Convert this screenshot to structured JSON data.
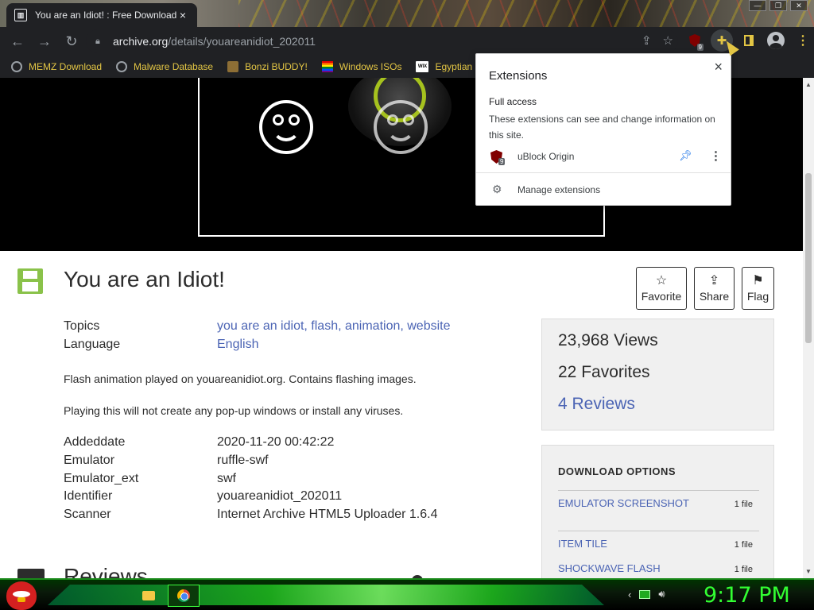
{
  "tab": {
    "title": "You are an Idiot! : Free Download",
    "favicon": "archive-org-icon",
    "close": "×"
  },
  "window_controls": {
    "minimize": "—",
    "maximize": "❐",
    "close": "✕"
  },
  "nav": {
    "back": "←",
    "forward": "→",
    "reload": "↻"
  },
  "omnibox": {
    "host": "archive.org",
    "path": "/details/youareanidiot_202011"
  },
  "extension_badge": "9",
  "bookmarks": [
    {
      "label": "MEMZ Download",
      "icon": "globe-icon"
    },
    {
      "label": "Malware Database",
      "icon": "globe-icon"
    },
    {
      "label": "Bonzi BUDDY!",
      "icon": "bonzi-icon"
    },
    {
      "label": "Windows ISOs",
      "icon": "rainbow-flag-icon"
    },
    {
      "label": "Egyptian Er",
      "icon": "wix-icon"
    }
  ],
  "wix_text": "WIX",
  "item": {
    "title": "You are an Idiot!",
    "actions": {
      "favorite": "Favorite",
      "share": "Share",
      "flag": "Flag"
    },
    "topics_label": "Topics",
    "topics_value": "you are an idiot, flash, animation, website",
    "language_label": "Language",
    "language_value": "English",
    "description_1": "Flash animation played on youareanidiot.org. Contains flashing images.",
    "description_2": "Playing this will not create any pop-up windows or install any viruses.",
    "metadata": [
      {
        "label": "Addeddate",
        "value": "2020-11-20 00:42:22"
      },
      {
        "label": "Emulator",
        "value": "ruffle-swf"
      },
      {
        "label": "Emulator_ext",
        "value": "swf"
      },
      {
        "label": "Identifier",
        "value": "youareanidiot_202011"
      },
      {
        "label": "Scanner",
        "value": "Internet Archive HTML5 Uploader 1.6.4"
      }
    ],
    "reviews_heading": "Reviews"
  },
  "stats": {
    "views": "23,968 Views",
    "favorites": "22 Favorites",
    "reviews": "4 Reviews"
  },
  "downloads": {
    "title": "DOWNLOAD OPTIONS",
    "items": [
      {
        "label": "EMULATOR SCREENSHOT",
        "count": "1 file"
      },
      {
        "label": "ITEM TILE",
        "count": "1 file"
      },
      {
        "label": "SHOCKWAVE FLASH",
        "count": "1 file"
      }
    ]
  },
  "extensions_popup": {
    "title": "Extensions",
    "section": "Full access",
    "description": "These extensions can see and change information on this site.",
    "extension_name": "uBlock Origin",
    "badge": "9",
    "manage": "Manage extensions"
  },
  "taskbar": {
    "clock": "9:17 PM"
  },
  "colors": {
    "accent_yellow": "#e2c544",
    "link_blue": "#4b64b4",
    "clock_green": "#32ff32",
    "item_green": "#8ac24a"
  }
}
